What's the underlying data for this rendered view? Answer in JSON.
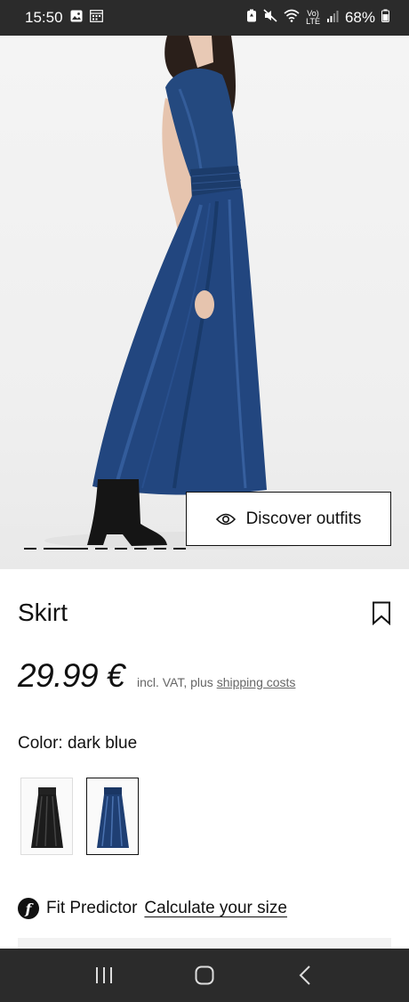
{
  "status": {
    "time": "15:50",
    "left_icons": [
      "image-icon",
      "calendar-icon"
    ],
    "right_icons": [
      "battery-saver-icon",
      "mute-icon",
      "wifi-icon",
      "volte-icon",
      "signal-icon",
      "battery-icon"
    ],
    "volte_line1": "Vo)",
    "volte_line2": "LTE",
    "battery": "68%"
  },
  "hero": {
    "discover_label": "Discover outfits",
    "page_indicator": {
      "total": 8,
      "active": 2
    }
  },
  "product": {
    "title": "Skirt",
    "price": "29.99 €",
    "price_note": "incl. VAT, plus",
    "shipping_link": "shipping costs",
    "color_label": "Color:",
    "color_value": "dark blue",
    "swatches": [
      {
        "name": "black",
        "color": "#1c1c1c",
        "selected": false
      },
      {
        "name": "dark blue",
        "color": "#1f3f73",
        "selected": true
      }
    ]
  },
  "fit": {
    "icon_letter": "f",
    "label": "Fit Predictor",
    "link": "Calculate your size"
  },
  "nav": {
    "buttons": [
      "recents-icon",
      "home-icon",
      "back-icon"
    ]
  },
  "colors": {
    "bar": "#2b2b2b",
    "dress": "#22467f"
  }
}
